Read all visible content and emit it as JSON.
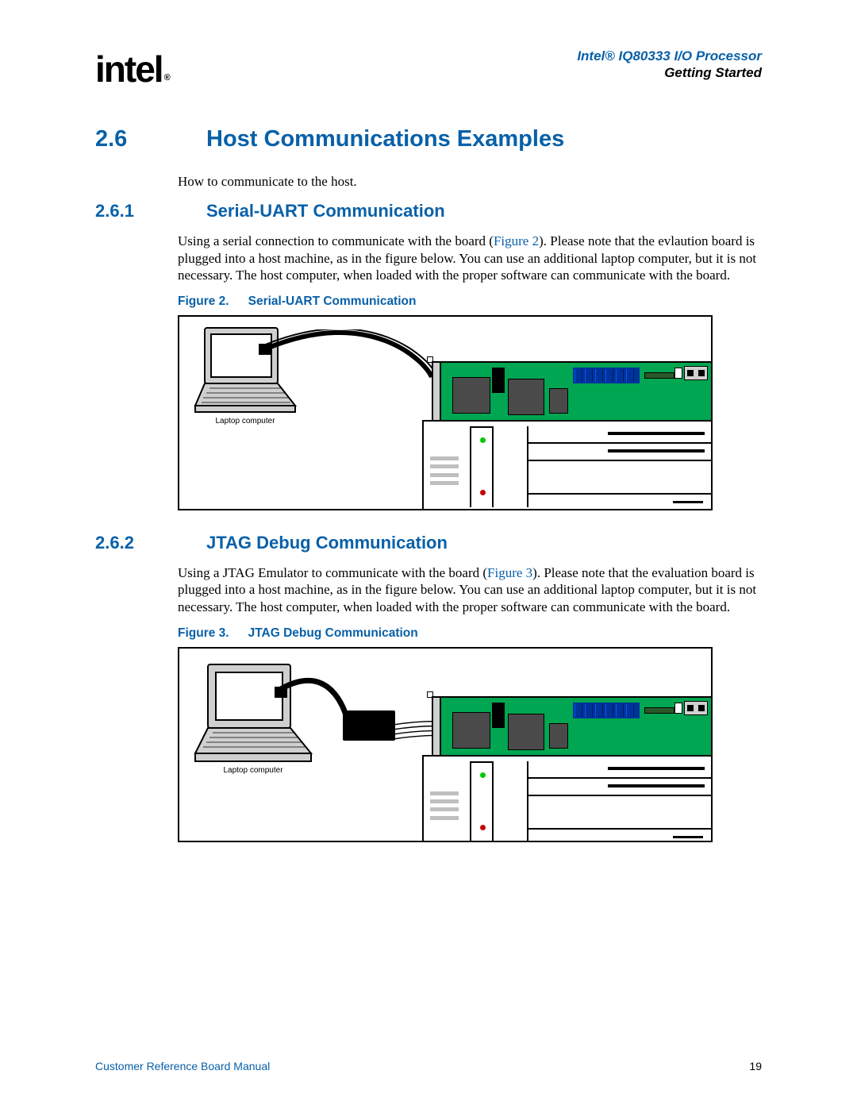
{
  "header": {
    "logo_text": "intel",
    "logo_reg": "®",
    "doc_title": "Intel® IQ80333 I/O Processor",
    "doc_section": "Getting Started"
  },
  "section": {
    "num": "2.6",
    "title": "Host Communications Examples",
    "intro": "How to communicate to the host."
  },
  "sub1": {
    "num": "2.6.1",
    "title": "Serial-UART Communication",
    "body_pre": "Using a serial connection to communicate with the board (",
    "fig_ref": "Figure 2",
    "body_post": "). Please note that the evlaution board is plugged into a host machine, as in the figure below. You can use an additional laptop computer, but it is not necessary. The host computer, when loaded with the proper software can communicate with the board.",
    "fig_caption_lead": "Figure 2.",
    "fig_caption": "Serial-UART Communication",
    "laptop_label": "Laptop computer"
  },
  "sub2": {
    "num": "2.6.2",
    "title": "JTAG Debug Communication",
    "body_pre": "Using a JTAG Emulator to communicate with the board (",
    "fig_ref": "Figure 3",
    "body_post": "). Please note that the evaluation board is plugged into a host machine, as in the figure below. You can use an additional laptop computer, but it is not necessary. The host computer, when loaded with the proper software can communicate with the board.",
    "fig_caption_lead": "Figure 3.",
    "fig_caption": "JTAG Debug Communication",
    "laptop_label": "Laptop computer"
  },
  "footer": {
    "left": "Customer Reference Board Manual",
    "page": "19"
  }
}
